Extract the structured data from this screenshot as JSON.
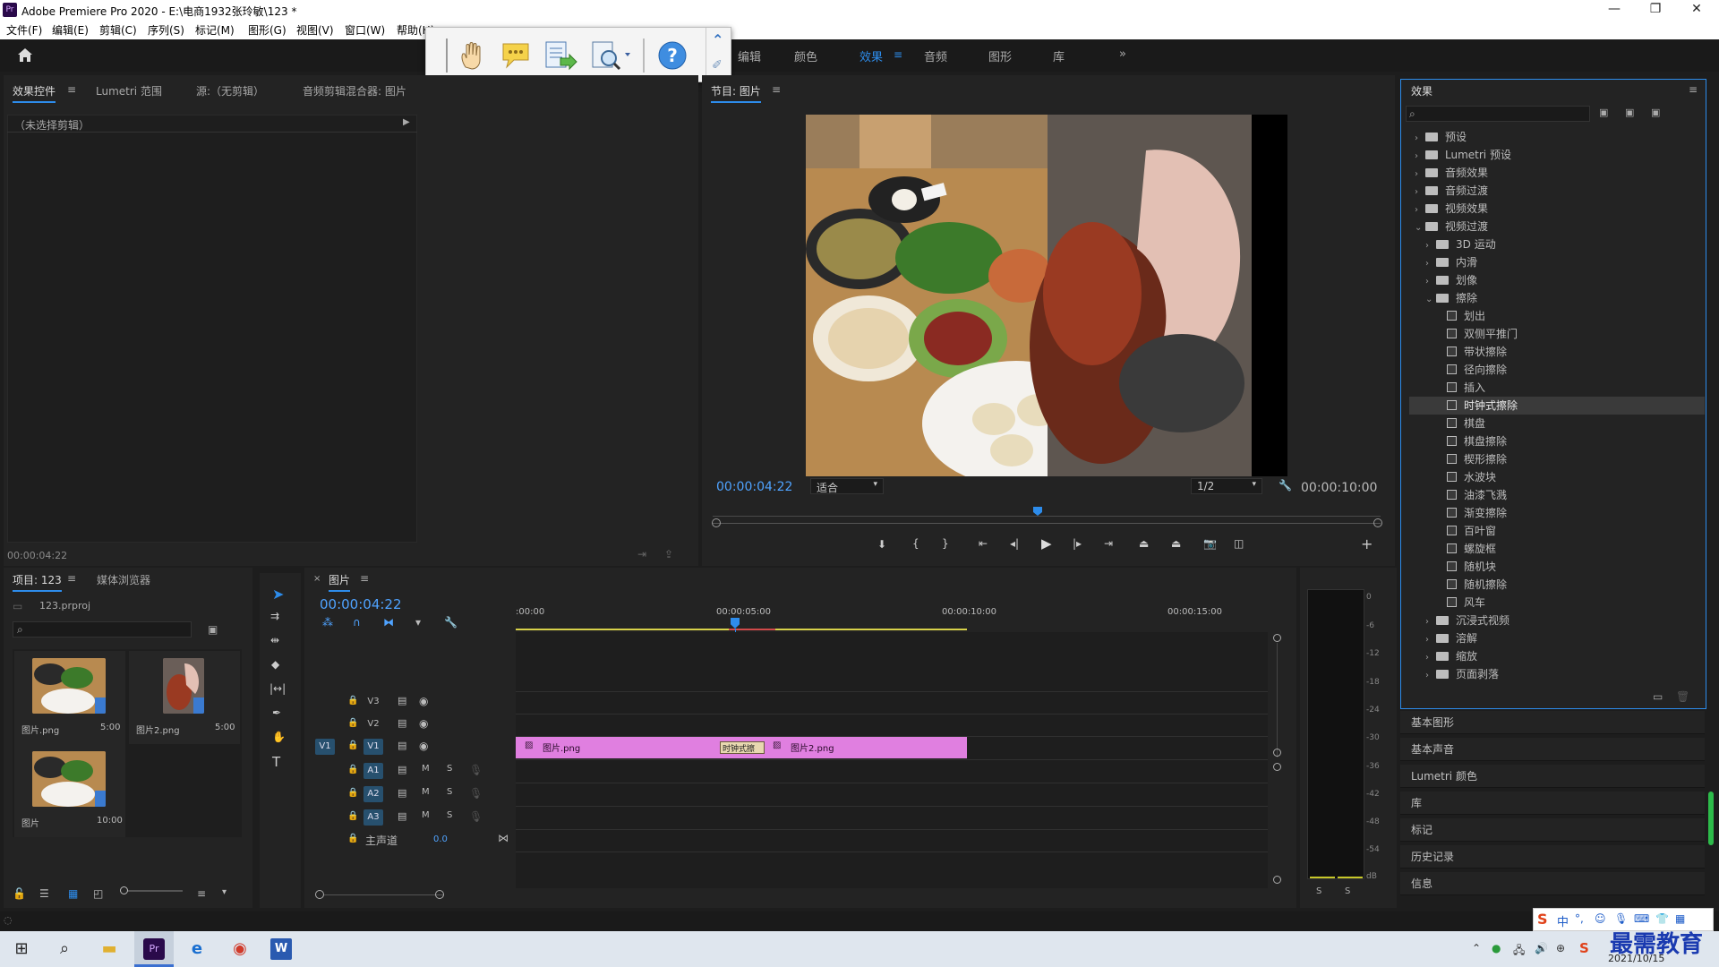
{
  "window": {
    "app_badge": "Pr",
    "title": "Adobe Premiere Pro 2020 - E:\\电商1932张玲敏\\123 *",
    "minimize": "—",
    "restore": "❐",
    "close": "✕"
  },
  "menu": [
    "文件(F)",
    "编辑(E)",
    "剪辑(C)",
    "序列(S)",
    "标记(M)",
    "图形(G)",
    "视图(V)",
    "窗口(W)",
    "帮助(H)"
  ],
  "workspaces": [
    "编辑",
    "颜色",
    "效果",
    "音频",
    "图形",
    "库",
    "»"
  ],
  "active_workspace": "效果",
  "source_panel": {
    "tabs": [
      "效果控件",
      "Lumetri 范围",
      "源:（无剪辑）",
      "音频剪辑混合器: 图片"
    ],
    "no_clip": "（未选择剪辑）",
    "timecode": "00:00:04:22"
  },
  "program": {
    "tab": "节目: 图片",
    "timecode": "00:00:04:22",
    "fit": "适合",
    "resolution": "1/2",
    "duration": "00:00:10:00"
  },
  "project": {
    "tabs": [
      "项目: 123",
      "媒体浏览器"
    ],
    "file": "123.prproj",
    "items": [
      {
        "name": "图片.png",
        "duration": "5:00"
      },
      {
        "name": "图片2.png",
        "duration": "5:00"
      },
      {
        "name": "图片",
        "duration": "10:00"
      }
    ]
  },
  "timeline": {
    "tab": "图片",
    "timecode": "00:00:04:22",
    "ruler": [
      ":00:00",
      "00:00:05:00",
      "00:00:10:00",
      "00:00:15:00"
    ],
    "video_tracks": [
      "V3",
      "V2",
      "V1"
    ],
    "audio_tracks": [
      "A1",
      "A2",
      "A3"
    ],
    "source_patch": "V1",
    "master_label": "主声道",
    "master_value": "0.0",
    "clips": [
      "图片.png",
      "图片2.png"
    ],
    "transition": "时钟式擦",
    "track_m": "M",
    "track_s": "S"
  },
  "meter": {
    "scale": [
      "0",
      "-6",
      "-12",
      "-18",
      "-24",
      "-30",
      "-36",
      "-42",
      "-48",
      "-54",
      "dB"
    ],
    "solo": [
      "S",
      "S"
    ]
  },
  "effects": {
    "title": "效果",
    "tree": [
      {
        "label": "预设",
        "level": 0,
        "type": "folder",
        "open": false
      },
      {
        "label": "Lumetri 预设",
        "level": 0,
        "type": "folder",
        "open": false
      },
      {
        "label": "音频效果",
        "level": 0,
        "type": "folder",
        "open": false
      },
      {
        "label": "音频过渡",
        "level": 0,
        "type": "folder",
        "open": false
      },
      {
        "label": "视频效果",
        "level": 0,
        "type": "folder",
        "open": false
      },
      {
        "label": "视频过渡",
        "level": 0,
        "type": "folder",
        "open": true
      },
      {
        "label": "3D 运动",
        "level": 1,
        "type": "folder",
        "open": false
      },
      {
        "label": "内滑",
        "level": 1,
        "type": "folder",
        "open": false
      },
      {
        "label": "划像",
        "level": 1,
        "type": "folder",
        "open": false
      },
      {
        "label": "擦除",
        "level": 1,
        "type": "folder",
        "open": true
      },
      {
        "label": "划出",
        "level": 2,
        "type": "fx"
      },
      {
        "label": "双侧平推门",
        "level": 2,
        "type": "fx"
      },
      {
        "label": "带状擦除",
        "level": 2,
        "type": "fx"
      },
      {
        "label": "径向擦除",
        "level": 2,
        "type": "fx"
      },
      {
        "label": "插入",
        "level": 2,
        "type": "fx"
      },
      {
        "label": "时钟式擦除",
        "level": 2,
        "type": "fx",
        "selected": true
      },
      {
        "label": "棋盘",
        "level": 2,
        "type": "fx"
      },
      {
        "label": "棋盘擦除",
        "level": 2,
        "type": "fx"
      },
      {
        "label": "楔形擦除",
        "level": 2,
        "type": "fx"
      },
      {
        "label": "水波块",
        "level": 2,
        "type": "fx"
      },
      {
        "label": "油漆飞溅",
        "level": 2,
        "type": "fx"
      },
      {
        "label": "渐变擦除",
        "level": 2,
        "type": "fx"
      },
      {
        "label": "百叶窗",
        "level": 2,
        "type": "fx"
      },
      {
        "label": "螺旋框",
        "level": 2,
        "type": "fx"
      },
      {
        "label": "随机块",
        "level": 2,
        "type": "fx"
      },
      {
        "label": "随机擦除",
        "level": 2,
        "type": "fx"
      },
      {
        "label": "风车",
        "level": 2,
        "type": "fx"
      },
      {
        "label": "沉浸式视频",
        "level": 1,
        "type": "folder",
        "open": false
      },
      {
        "label": "溶解",
        "level": 1,
        "type": "folder",
        "open": false
      },
      {
        "label": "缩放",
        "level": 1,
        "type": "folder",
        "open": false
      },
      {
        "label": "页面剥落",
        "level": 1,
        "type": "folder",
        "open": false
      }
    ]
  },
  "side_panels": [
    "基本图形",
    "基本声音",
    "Lumetri 颜色",
    "库",
    "标记",
    "历史记录",
    "信息"
  ],
  "taskbar": {
    "date": "2021/10/15",
    "watermark": "最需教育",
    "ime": "中"
  }
}
